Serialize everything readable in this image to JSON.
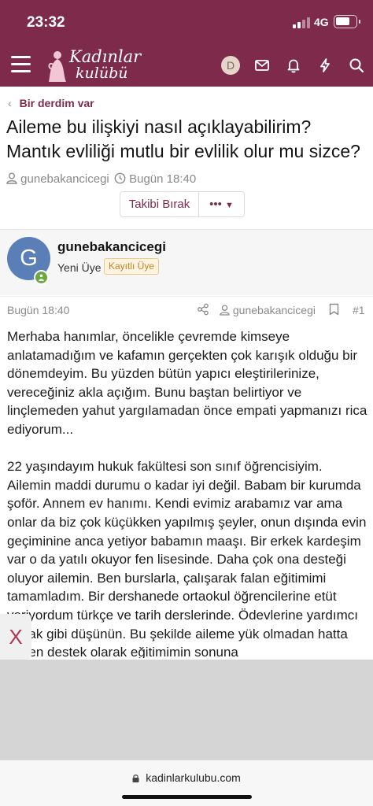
{
  "status_bar": {
    "time": "23:32",
    "network": "4G"
  },
  "brand": {
    "line1": "Kadınlar",
    "line2": "kulübü",
    "color": "#7d2a4b"
  },
  "nav": {
    "avatar_letter": "D"
  },
  "breadcrumb": {
    "label": "Bir derdim var"
  },
  "thread": {
    "title": "Aileme bu ilişkiyi nasıl açıklayabilirim? Mantık evliliği mutlu bir evlilik olur mu sizce?",
    "author": "gunebakancicegi",
    "date": "Bugün 18:40",
    "follow_label": "Takibi Bırak",
    "more_label": "•••"
  },
  "post": {
    "avatar_letter": "G",
    "username": "gunebakancicegi",
    "role": "Yeni Üye",
    "badge": "Kayıtlı Üye",
    "date": "Bugün 18:40",
    "author": "gunebakancicegi",
    "number": "#1",
    "paragraphs": [
      "Merhaba hanımlar, öncelikle çevremde kimseye anlatamadığım ve kafamın gerçekten çok karışık olduğu bir dönemdeyim. Bu yüzden bütün yapıcı eleştirilerinize, vereceğiniz akla açığım. Bunu baştan belirtiyor ve linçlemeden yahut yargılamadan önce empati yapmanızı rica ediyorum...",
      "22 yaşındayım hukuk fakültesi son sınıf öğrencisiyim. Ailemin maddi durumu o kadar iyi değil. Babam bir kurumda şoför. Annem ev hanımı. Kendi evimiz arabamız var ama onlar da biz çok küçükken yapılmış şeyler, onun dışında evin geçiminine anca yetiyor babamın maaşı. Bir erkek kardeşim var o da yatılı okuyor fen lisesinde. Daha çok ona desteği oluyor ailemin. Ben burslarla, çalışarak falan eğitimimi tamamladım. Bir dershanede ortaokul öğrencilerine etüt veriyordum türkçe ve tarih derslerinde. Ödevlerine yardımcı olmak gibi düşünün. Bu şekilde aileme yük olmadan hatta bazen destek olarak eğitimimin sonuna"
    ]
  },
  "ad": {
    "close_label": "X"
  },
  "browser": {
    "url": "kadinlarkulubu.com"
  }
}
